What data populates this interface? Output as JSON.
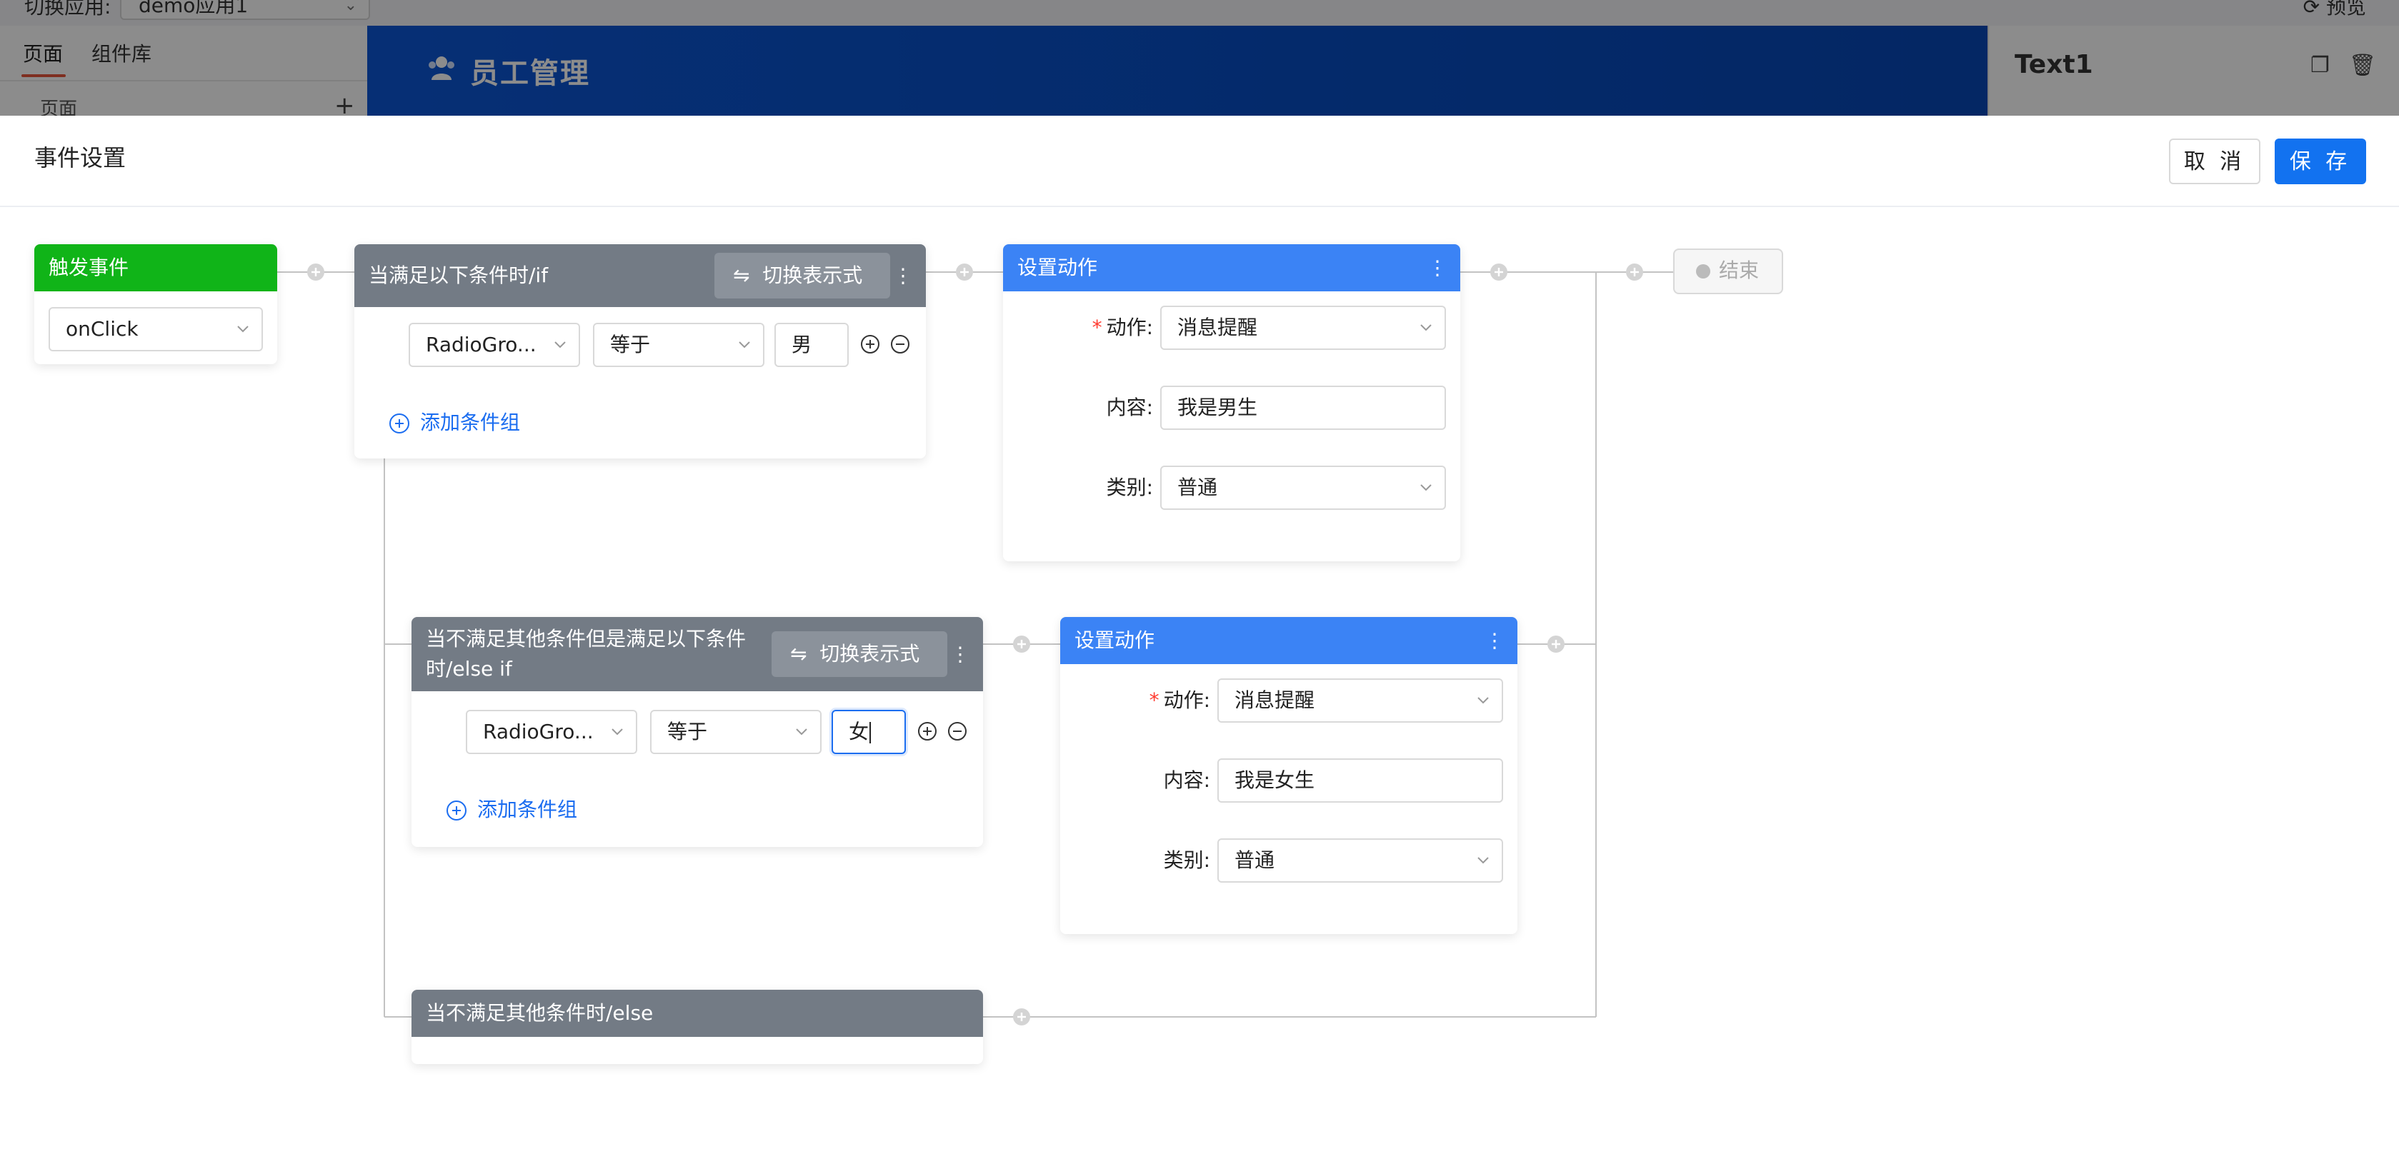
{
  "background": {
    "app_switch_label": "切换应用:",
    "app_switch_value": "demo应用1",
    "preview_label": "预览",
    "left_tabs": [
      "页面",
      "组件库"
    ],
    "pages_label": "页面",
    "pages_add": "+",
    "banner_title": "员工管理",
    "selected_component": "Text1"
  },
  "drawer": {
    "title": "事件设置",
    "cancel_label": "取 消",
    "save_label": "保 存"
  },
  "trigger": {
    "title": "触发事件",
    "event_value": "onClick"
  },
  "branches": {
    "if": {
      "title": "当满足以下条件时/if",
      "toggle_label": "切换表示式",
      "field": "RadioGro...",
      "operator": "等于",
      "value": "男",
      "add_group": "添加条件组"
    },
    "elseif": {
      "title_line1": "当不满足其他条件但是满足以下条件",
      "title_line2": "时/else if",
      "toggle_label": "切换表示式",
      "field": "RadioGro...",
      "operator": "等于",
      "value": "女",
      "add_group": "添加条件组"
    },
    "else": {
      "title": "当不满足其他条件时/else"
    }
  },
  "actions": [
    {
      "title": "设置动作",
      "action_label": "动作:",
      "action_value": "消息提醒",
      "content_label": "内容:",
      "content_value": "我是男生",
      "category_label": "类别:",
      "category_value": "普通"
    },
    {
      "title": "设置动作",
      "action_label": "动作:",
      "action_value": "消息提醒",
      "content_label": "内容:",
      "content_value": "我是女生",
      "category_label": "类别:",
      "category_value": "普通"
    }
  ],
  "end": {
    "label": "结束"
  },
  "toggle_icon": "⇋",
  "menu_icon": "⋮",
  "required_mark": "*",
  "colors": {
    "trigger": "#10b418",
    "condition": "#737b85",
    "action": "#3b83f5",
    "primary": "#1272f0",
    "link": "#1b6df0"
  }
}
